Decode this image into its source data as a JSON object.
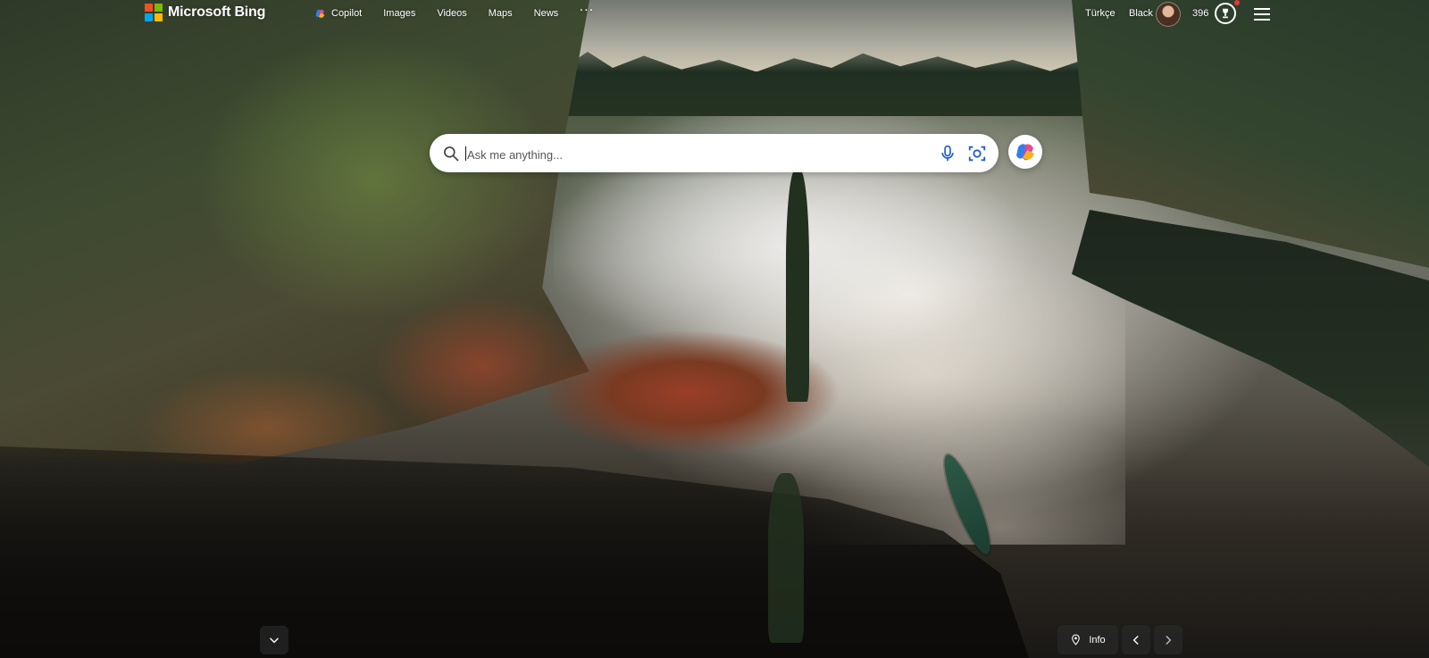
{
  "header": {
    "logo_text": "Microsoft Bing",
    "nav": [
      {
        "label": "Copilot",
        "icon": "copilot-icon"
      },
      {
        "label": "Images"
      },
      {
        "label": "Videos"
      },
      {
        "label": "Maps"
      },
      {
        "label": "News"
      },
      {
        "label": "···"
      }
    ],
    "language": "Türkçe",
    "user_name": "Black",
    "reward_points": "396",
    "icons": {
      "rewards": "trophy-icon",
      "menu": "hamburger-menu-icon"
    }
  },
  "search": {
    "placeholder": "Ask me anything...",
    "value": "",
    "icons": [
      "search-icon",
      "microphone-icon",
      "visual-search-icon",
      "copilot-icon"
    ]
  },
  "footer": {
    "info_label": "Info",
    "icons": [
      "chevron-down-icon",
      "location-pin-icon",
      "chevron-left-icon",
      "chevron-right-icon"
    ]
  },
  "colors": {
    "ms_red": "#f25022",
    "ms_green": "#7fba00",
    "ms_blue": "#00a4ef",
    "ms_yellow": "#ffb900",
    "overlay_button": "#282828"
  }
}
